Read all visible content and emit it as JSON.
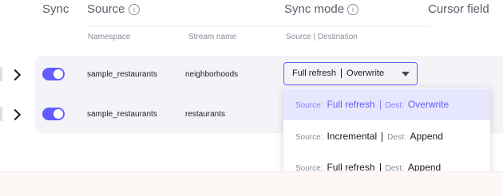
{
  "header": {
    "sync": "Sync",
    "source": "Source",
    "sync_mode": "Sync mode",
    "cursor_field": "Cursor field",
    "info_glyph": "i"
  },
  "subheader": {
    "namespace": "Namespace",
    "stream_name": "Stream name",
    "source_destination": "Source | Destination"
  },
  "rows": [
    {
      "namespace": "sample_restaurants",
      "stream": "neighborhoods",
      "sync_enabled": true
    },
    {
      "namespace": "sample_restaurants",
      "stream": "restaurants",
      "sync_enabled": true
    }
  ],
  "select": {
    "source_mode": "Full refresh",
    "dest_mode": "Overwrite"
  },
  "dropdown": {
    "source_label": "Source:",
    "dest_label": "Dest:",
    "options": [
      {
        "source": "Full refresh",
        "dest": "Overwrite",
        "selected": true
      },
      {
        "source": "Incremental",
        "dest": "Append",
        "selected": false
      },
      {
        "source": "Full refresh",
        "dest": "Append",
        "selected": false
      }
    ]
  },
  "colors": {
    "accent": "#615eff",
    "selected_bg": "#e6e6ff",
    "row_bg": "#f4f4f8"
  },
  "icons": [
    "info-icon",
    "chevron-right-icon",
    "caret-down-icon"
  ]
}
